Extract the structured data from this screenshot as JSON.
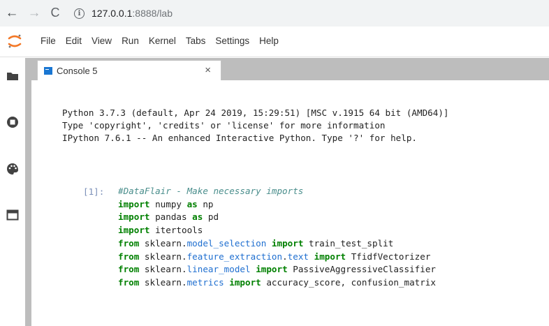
{
  "browser": {
    "url_host": "127.0.0.1",
    "url_rest": ":8888/lab",
    "back_glyph": "←",
    "forward_glyph": "→",
    "reload_glyph": "C",
    "info_glyph": "i"
  },
  "menu": [
    "File",
    "Edit",
    "View",
    "Run",
    "Kernel",
    "Tabs",
    "Settings",
    "Help"
  ],
  "tab": {
    "label": "Console 5",
    "close_glyph": "×"
  },
  "console": {
    "banner": [
      "Python 3.7.3 (default, Apr 24 2019, 15:29:51) [MSC v.1915 64 bit (AMD64)]",
      "Type 'copyright', 'credits' or 'license' for more information",
      "IPython 7.6.1 -- An enhanced Interactive Python. Type '?' for help."
    ],
    "prompt": "[1]:",
    "code": {
      "comment": "#DataFlair - Make necessary imports",
      "lines": [
        {
          "tokens": [
            [
              "kw",
              "import"
            ],
            [
              "txt",
              " numpy "
            ],
            [
              "kw",
              "as"
            ],
            [
              "txt",
              " np"
            ]
          ]
        },
        {
          "tokens": [
            [
              "kw",
              "import"
            ],
            [
              "txt",
              " pandas "
            ],
            [
              "kw",
              "as"
            ],
            [
              "txt",
              " pd"
            ]
          ]
        },
        {
          "tokens": [
            [
              "kw",
              "import"
            ],
            [
              "txt",
              " itertools"
            ]
          ]
        },
        {
          "tokens": [
            [
              "kw",
              "from"
            ],
            [
              "txt",
              " sklearn."
            ],
            [
              "mod",
              "model_selection"
            ],
            [
              "txt",
              " "
            ],
            [
              "kw",
              "import"
            ],
            [
              "txt",
              " train_test_split"
            ]
          ]
        },
        {
          "tokens": [
            [
              "kw",
              "from"
            ],
            [
              "txt",
              " sklearn."
            ],
            [
              "mod",
              "feature_extraction"
            ],
            [
              "txt",
              "."
            ],
            [
              "mod",
              "text"
            ],
            [
              "txt",
              " "
            ],
            [
              "kw",
              "import"
            ],
            [
              "txt",
              " TfidfVectorizer"
            ]
          ]
        },
        {
          "tokens": [
            [
              "kw",
              "from"
            ],
            [
              "txt",
              " sklearn."
            ],
            [
              "mod",
              "linear_model"
            ],
            [
              "txt",
              " "
            ],
            [
              "kw",
              "import"
            ],
            [
              "txt",
              " PassiveAggressiveClassifier"
            ]
          ]
        },
        {
          "tokens": [
            [
              "kw",
              "from"
            ],
            [
              "txt",
              " sklearn."
            ],
            [
              "mod",
              "metrics"
            ],
            [
              "txt",
              " "
            ],
            [
              "kw",
              "import"
            ],
            [
              "txt",
              " accuracy_score, confusion_matrix"
            ]
          ]
        }
      ]
    }
  },
  "colors": {
    "accent": "#1976d2",
    "jupyter_orange": "#f37726",
    "keyword": "#008000",
    "comment": "#4a8e8c",
    "module": "#1f6fd0"
  },
  "sidebar_icons": [
    "folder-icon",
    "running-icon",
    "palette-icon",
    "tabs-icon"
  ]
}
